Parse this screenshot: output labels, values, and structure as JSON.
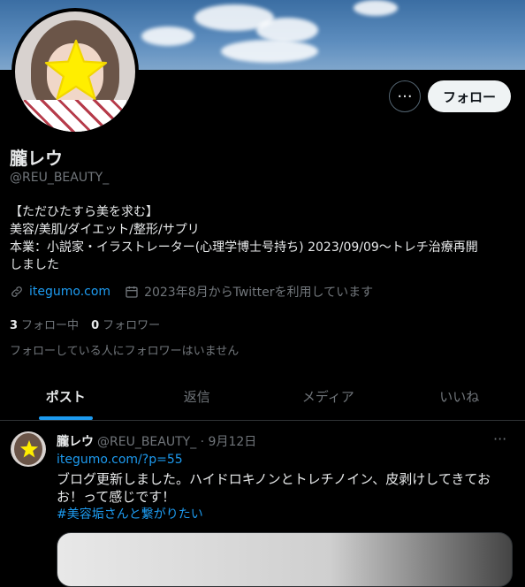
{
  "profile": {
    "name": "朧レウ",
    "handle": "@REU_BEAUTY_",
    "bio": [
      "【ただひたすら美を求む】",
      "美容/美肌/ダイエット/整形/サプリ",
      "本業：小説家・イラストレーター(心理学博士号持ち) 2023/09/09〜トレチ治療再開",
      "しました"
    ],
    "link": "itegumo.com",
    "joined": "2023年8月からTwitterを利用しています",
    "following_count": "3",
    "following_label": "フォロー中",
    "followers_count": "0",
    "followers_label": "フォロワー",
    "no_followers_note": "フォローしている人にフォロワーはいません"
  },
  "actions": {
    "more": "···",
    "follow": "フォロー"
  },
  "tabs": [
    {
      "label": "ポスト",
      "active": true
    },
    {
      "label": "返信",
      "active": false
    },
    {
      "label": "メディア",
      "active": false
    },
    {
      "label": "いいね",
      "active": false
    }
  ],
  "tweet": {
    "name": "朧レウ",
    "meta": "@REU_BEAUTY_ · 9月12日",
    "more": "···",
    "link": "itegumo.com/?p=55",
    "text": [
      "ブログ更新しました。ハイドロキノンとトレチノイン、皮剥けしてきてお",
      "お！って感じです！"
    ],
    "hashtag": "#美容垢さんと繋がりたい"
  },
  "icons": {
    "link": "link-icon",
    "calendar": "calendar-icon",
    "more": "more-icon"
  },
  "colors": {
    "accent": "#1d9bf0",
    "background": "#000000",
    "star": "#ffee00"
  }
}
